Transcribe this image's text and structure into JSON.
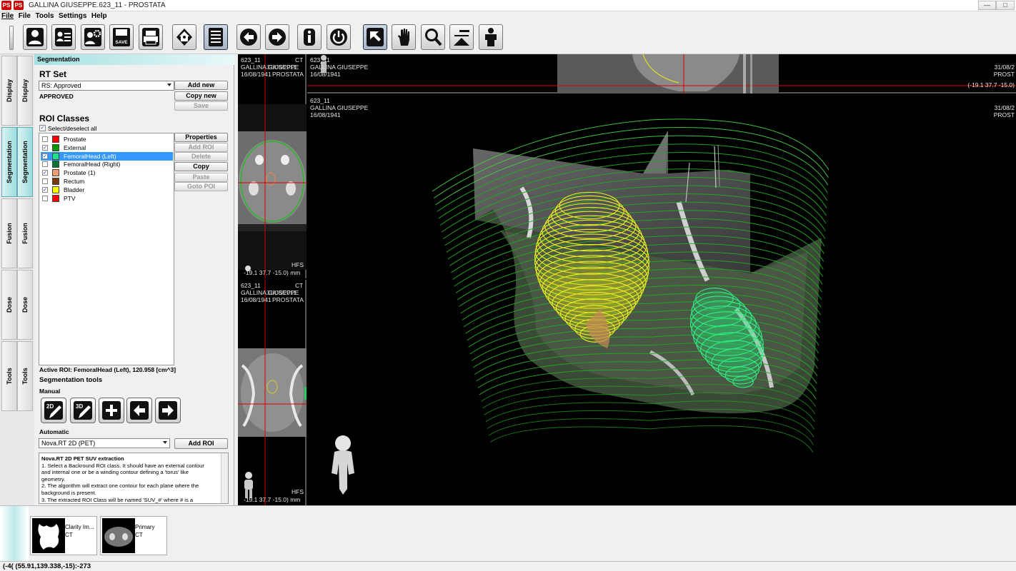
{
  "window": {
    "title": "GALLINA GIUSEPPE.623_11 - PROSTATA",
    "app_icon_text": "PS",
    "minimize": "—",
    "maximize": "□",
    "close": "✕"
  },
  "menu": {
    "file1": "File",
    "file2": "File",
    "tools": "Tools",
    "settings": "Settings",
    "help": "Help"
  },
  "toolbar": {
    "icons": [
      "patient-icon",
      "patient-card-icon",
      "patient-settings-icon",
      "save-icon",
      "print-icon",
      "home-icon",
      "document-icon",
      "arrow-left-icon",
      "arrow-right-icon",
      "info-icon",
      "power-icon",
      "pointer-icon",
      "hand-icon",
      "magnifier-icon",
      "zoom-minus-icon",
      "person-icon"
    ],
    "save_text": "SAVE"
  },
  "tabs": [
    {
      "label": "Display"
    },
    {
      "label": "Display"
    },
    {
      "label": "Segmentation"
    },
    {
      "label": "Segmentation"
    },
    {
      "label": "Fusion"
    },
    {
      "label": "Fusion"
    },
    {
      "label": "Dose"
    },
    {
      "label": "Dose"
    },
    {
      "label": "Tools"
    },
    {
      "label": "Tools"
    }
  ],
  "panel": {
    "header": "Segmentation",
    "rtset_title": "RT Set",
    "rtset_value": "RS: Approved",
    "rtset_status": "APPROVED",
    "add_new": "Add new",
    "copy_new": "Copy new",
    "save": "Save",
    "roi_title": "ROI Classes",
    "select_all": "Select/deselect all",
    "rois": [
      {
        "name": "Prostate",
        "color": "#ff0000",
        "checked": false,
        "selected": false
      },
      {
        "name": "External",
        "color": "#009900",
        "checked": true,
        "selected": false
      },
      {
        "name": "FemoralHead (Left)",
        "color": "#22dd88",
        "checked": true,
        "selected": true
      },
      {
        "name": "FemoralHead (Right)",
        "color": "#007733",
        "checked": false,
        "selected": false
      },
      {
        "name": "Prostate (1)",
        "color": "#f0a070",
        "checked": true,
        "selected": false
      },
      {
        "name": "Rectum",
        "color": "#7a3a10",
        "checked": false,
        "selected": false
      },
      {
        "name": "Bladder",
        "color": "#ffff00",
        "checked": true,
        "selected": false
      },
      {
        "name": "PTV",
        "color": "#ff0000",
        "checked": false,
        "selected": false
      }
    ],
    "properties": "Properties",
    "add_roi": "Add ROI",
    "delete": "Delete",
    "copy": "Copy",
    "paste": "Paste",
    "goto_poi": "Goto POI",
    "active_roi": "Active ROI: FemoralHead (Left), 120.958 [cm^3]",
    "seg_tools_title": "Segmentation tools",
    "manual_label": "Manual",
    "tool_2d": "2D",
    "tool_3d": "3D",
    "automatic_label": "Automatic",
    "auto_value": "Nova.RT 2D (PET)",
    "auto_add_roi": "Add ROI",
    "info_title": "Nova.RT 2D PET SUV extraction",
    "info_lines": [
      "1. Select a Backround ROI class. It should have an external contour",
      "and internal one or be a winding contour defining a 'torus' like",
      "geometry.",
      "2. The algorithm will extract one contour for each plane where the",
      "background is present.",
      "3. The extracted ROI Class will be named 'SUV_#' where # is a"
    ]
  },
  "viewer": {
    "small1": {
      "id": "623_11",
      "mod": "CT",
      "name": "GALLINA GIUSEPPE",
      "date_overlap": "31/08/2011",
      "dob": "16/08/1941",
      "study": "PROSTATA",
      "orient": "HFS",
      "coords": "-19.1 37.7 -15.0) mm"
    },
    "small2": {
      "id": "623_11",
      "mod": "CT",
      "name": "GALLINA GIUSEPPE",
      "date_overlap": "31/08/2011",
      "dob": "16/08/1941",
      "study": "PROSTATA",
      "orient": "HFS",
      "coords": "-19.1 37.7 -15.0) mm"
    },
    "top": {
      "id": "623_11",
      "name": "GALLINA GIUSEPPE",
      "dob": "16/08/1941",
      "date": "31/08/2",
      "study": "PROST",
      "coords": "(-19.1 37.7 -15.0)"
    },
    "main": {
      "id": "623_11",
      "name": "GALLINA GIUSEPPE",
      "dob": "16/08/1941",
      "date": "31/08/2",
      "study": "PROST"
    }
  },
  "thumbs": [
    {
      "line1": "Clarity Im...",
      "line2": "CT"
    },
    {
      "line1": "Primary",
      "line2": "CT"
    }
  ],
  "status": "(-4( (55.91,139.338,-15):-273"
}
